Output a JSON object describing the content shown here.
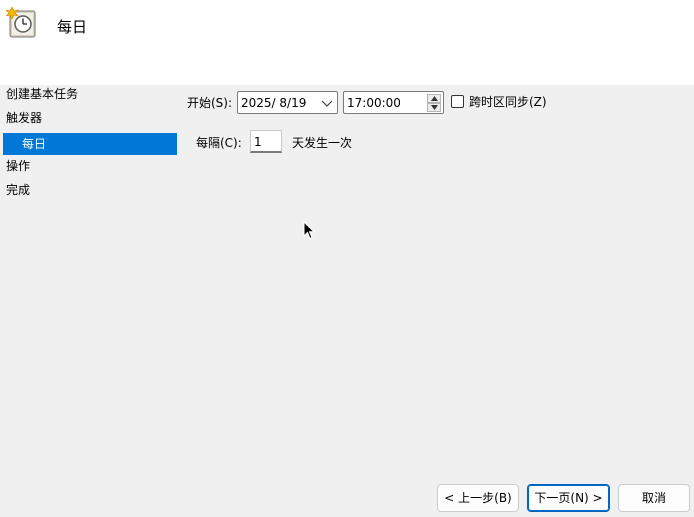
{
  "header": {
    "title": "每日",
    "icon": "task-scheduler-clock-icon"
  },
  "nav": {
    "items": [
      "创建基本任务",
      "触发器",
      "每日",
      "操作",
      "完成"
    ],
    "selected_index": 2
  },
  "start": {
    "label": "开始(S):",
    "date": "2025/  8/19",
    "time": "17:00:00",
    "sync_label": "跨时区同步(Z)",
    "sync_checked": false
  },
  "recur": {
    "label": "每隔(C):",
    "value": "1",
    "suffix": "天发生一次"
  },
  "buttons": {
    "back": "< 上一步(B)",
    "next": "下一页(N) >",
    "cancel": "取消"
  },
  "colors": {
    "selection": "#0078d7",
    "primary_border": "#0067c0"
  }
}
